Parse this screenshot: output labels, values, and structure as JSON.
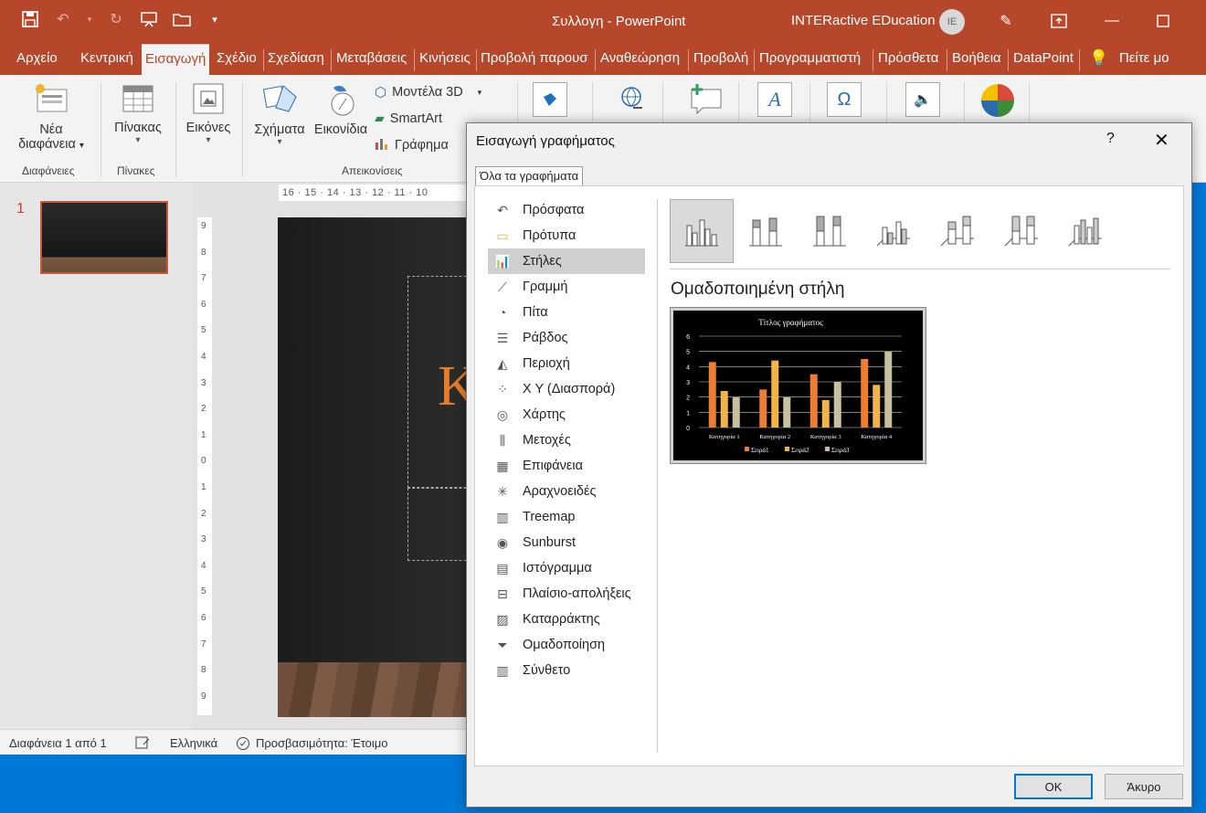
{
  "window": {
    "title": "Συλλογη  -  PowerPoint",
    "user_name": "INTERactive EDucation",
    "user_initials": "IE"
  },
  "tabs": [
    "Αρχείο",
    "Κεντρική",
    "Εισαγωγή",
    "Σχέδιο",
    "Σχεδίαση",
    "Μεταβάσεις",
    "Κινήσεις",
    "Προβολή παρουσ",
    "Αναθεώρηση",
    "Προβολή",
    "Προγραμματιστή",
    "Πρόσθετα",
    "Βοήθεια",
    "DataPoint"
  ],
  "tell_me": "Πείτε μο",
  "ribbon": {
    "new_slide_line1": "Νέα",
    "new_slide_line2": "διαφάνεια",
    "group_slides": "Διαφάνειες",
    "table": "Πίνακας",
    "group_tables": "Πίνακες",
    "images": "Εικόνες",
    "shapes": "Σχήματα",
    "icons": "Εικονίδια",
    "models3d": "Μοντέλα 3D",
    "smartart": "SmartArt",
    "chart": "Γράφημα",
    "group_illustrations": "Απεικονίσεις"
  },
  "thumbnails": {
    "slide_number": "1"
  },
  "ruler": {
    "h": "16 · 15 · 14 · 13 · 12 · 11 · 10"
  },
  "vruler_labels": [
    "9",
    "8",
    "7",
    "6",
    "5",
    "4",
    "3",
    "2",
    "1",
    "0",
    "1",
    "2",
    "3",
    "4",
    "5",
    "6",
    "7",
    "8",
    "9"
  ],
  "slide": {
    "big_letter": "K"
  },
  "status": {
    "slide_info": "Διαφάνεια 1 από 1",
    "language": "Ελληνικά",
    "accessibility": "Προσβασιμότητα: Έτοιμο"
  },
  "dialog": {
    "title": "Εισαγωγή γραφήματος",
    "help": "?",
    "tab_all": "Όλα τα γραφήματα",
    "categories": [
      "Πρόσφατα",
      "Πρότυπα",
      "Στήλες",
      "Γραμμή",
      "Πίτα",
      "Ράβδος",
      "Περιοχή",
      "X Y (Διασπορά)",
      "Χάρτης",
      "Μετοχές",
      "Επιφάνεια",
      "Αραχνοειδές",
      "Treemap",
      "Sunburst",
      "Ιστόγραμμα",
      "Πλαίσιο-απολήξεις",
      "Καταρράκτης",
      "Ομαδοποίηση",
      "Σύνθετο"
    ],
    "selected_category": "Στήλες",
    "subtype_name": "Ομαδοποιημένη στήλη",
    "ok": "OK",
    "cancel": "Άκυρο"
  },
  "chart_data": {
    "type": "bar",
    "title": "Τίτλος γραφήματος",
    "categories": [
      "Κατηγορία 1",
      "Κατηγορία 2",
      "Κατηγορία 3",
      "Κατηγορία 4"
    ],
    "series": [
      {
        "name": "Σειρά1",
        "values": [
          4.3,
          2.5,
          3.5,
          4.5
        ],
        "color": "#ed7d31"
      },
      {
        "name": "Σειρά2",
        "values": [
          2.4,
          4.4,
          1.8,
          2.8
        ],
        "color": "#f2b44a"
      },
      {
        "name": "Σειρά3",
        "values": [
          2,
          2,
          3,
          5
        ],
        "color": "#c8bfa0"
      }
    ],
    "ylim": [
      0,
      6
    ],
    "yticks": [
      "0",
      "1",
      "2",
      "3",
      "4",
      "5",
      "6"
    ],
    "grid": true,
    "legend": "bottom"
  }
}
